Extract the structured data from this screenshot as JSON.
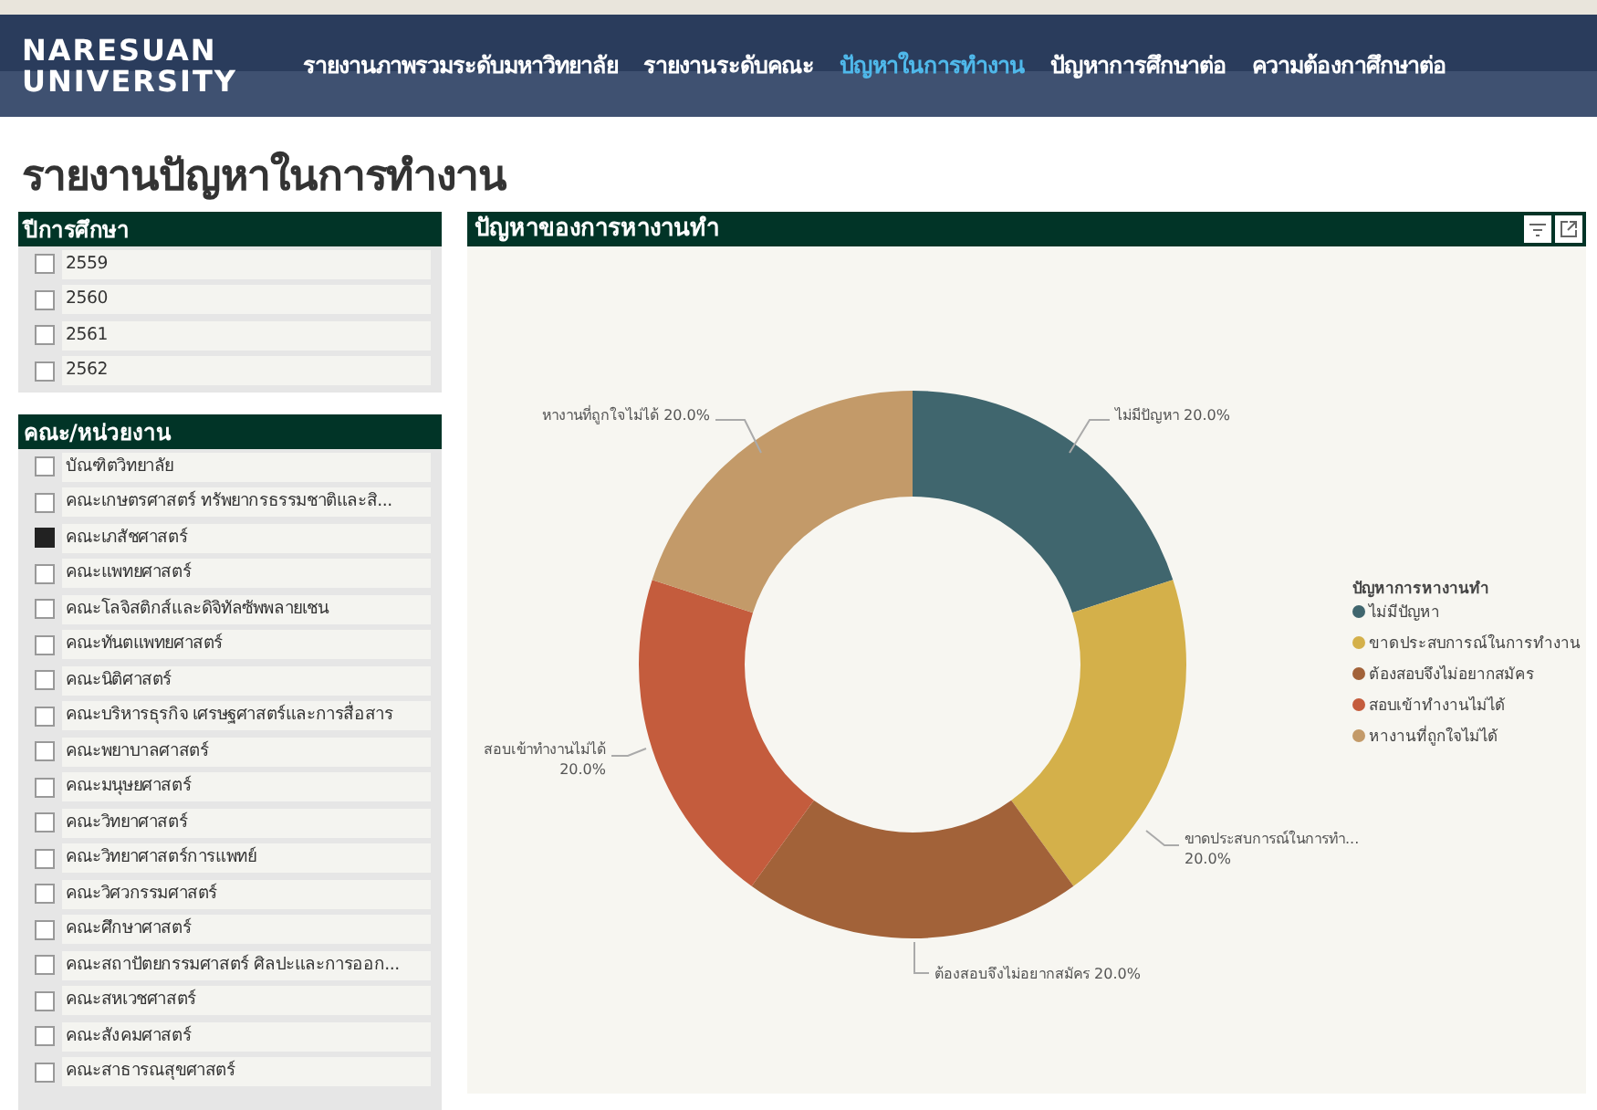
{
  "navbar": {
    "logo_lines": [
      "NARESUAN",
      "UNIVERSITY"
    ],
    "links": [
      {
        "label": "รายงานภาพรวมระดับมหาวิทยาลัย",
        "selected": false
      },
      {
        "label": "รายงานระดับคณะ",
        "selected": false
      },
      {
        "label": "ปัญหาในการทำงาน",
        "selected": true
      },
      {
        "label": "ปัญหาการศึกษาต่อ",
        "selected": false
      },
      {
        "label": "ความต้องกาศึกษาต่อ",
        "selected": false
      }
    ]
  },
  "page_title": "รายงานปัญหาในการทำงาน",
  "slicers": [
    {
      "title": "ปีการศึกษา",
      "items": [
        {
          "label": "2559",
          "checked": false
        },
        {
          "label": "2560",
          "checked": false
        },
        {
          "label": "2561",
          "checked": false
        },
        {
          "label": "2562",
          "checked": false
        }
      ]
    },
    {
      "title": "คณะ/หน่วยงาน",
      "items": [
        {
          "label": "บัณฑิตวิทยาลัย",
          "checked": false
        },
        {
          "label": "คณะเกษตรศาสตร์ ทรัพยากรธรรมชาติและสิ...",
          "checked": false
        },
        {
          "label": "คณะเภสัชศาสตร์",
          "checked": true
        },
        {
          "label": "คณะแพทยศาสตร์",
          "checked": false
        },
        {
          "label": "คณะโลจิสติกส์และดิจิทัลซัพพลายเชน",
          "checked": false
        },
        {
          "label": "คณะทันตแพทยศาสตร์",
          "checked": false
        },
        {
          "label": "คณะนิติศาสตร์",
          "checked": false
        },
        {
          "label": "คณะบริหารธุรกิจ เศรษฐศาสตร์และการสื่อสาร",
          "checked": false
        },
        {
          "label": "คณะพยาบาลศาสตร์",
          "checked": false
        },
        {
          "label": "คณะมนุษยศาสตร์",
          "checked": false
        },
        {
          "label": "คณะวิทยาศาสตร์",
          "checked": false
        },
        {
          "label": "คณะวิทยาศาสตร์การแพทย์",
          "checked": false
        },
        {
          "label": "คณะวิศวกรรมศาสตร์",
          "checked": false
        },
        {
          "label": "คณะศึกษาศาสตร์",
          "checked": false
        },
        {
          "label": "คณะสถาปัตยกรรมศาสตร์ ศิลปะและการออก...",
          "checked": false
        },
        {
          "label": "คณะสหเวชศาสตร์",
          "checked": false
        },
        {
          "label": "คณะสังคมศาสตร์",
          "checked": false
        },
        {
          "label": "คณะสาธารณสุขศาสตร์",
          "checked": false
        }
      ]
    }
  ],
  "chart_panel": {
    "title": "ปัญหาของการหางานทำ",
    "chart_data": {
      "type": "donut",
      "categories": [
        "ไม่มีปัญหา",
        "ขาดประสบการณ์ในการทำงาน",
        "ต้องสอบจึงไม่อยากสมัคร",
        "สอบเข้าทำงานไม่ได้",
        "หางานที่ถูกใจไม่ได้"
      ],
      "series": [
        {
          "name": "ปัญหาการหางานทำ",
          "values": [
            20,
            20,
            20,
            20,
            20
          ]
        }
      ],
      "colors": [
        "#40666e",
        "#d4b04a",
        "#a26239",
        "#c45c3d",
        "#c39a69"
      ],
      "legend": true,
      "value_labels": [
        "20.0%",
        "20.0%",
        "20.0%",
        "20.0%",
        "20.0%"
      ]
    },
    "slice_labels": [
      "ไม่มีปัญหา",
      "ขาดประสบการณ์ในการทำ...",
      "ต้องสอบจึงไม่อยากสมัคร",
      "สอบเข้าทำงานไม่ได้",
      "หางานที่ถูกใจไม่ได้"
    ]
  }
}
